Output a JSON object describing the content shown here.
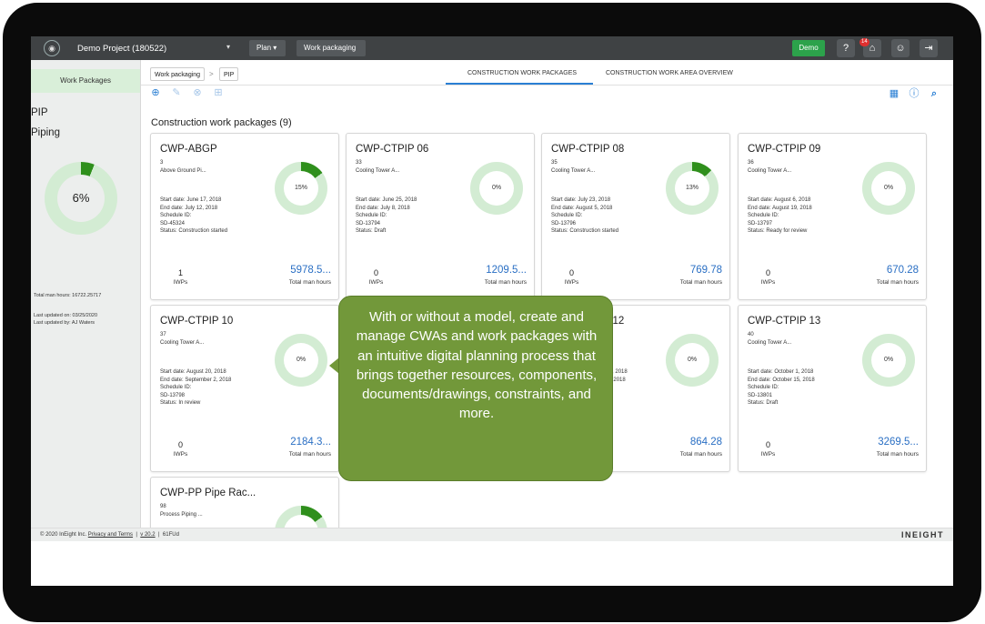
{
  "topbar": {
    "project": "Demo Project (180522)",
    "nav1": "Plan",
    "nav2": "Work packaging",
    "demo_button": "Demo",
    "notification_count": "14",
    "icons": [
      "help-icon",
      "bell-icon",
      "user-icon",
      "logout-icon"
    ]
  },
  "sidebar": {
    "tab": "Work Packages",
    "heading1": "PIP",
    "heading2": "Piping",
    "donut_percent_label": "6%",
    "donut_fraction": 0.06,
    "total_man_hours": "Total man hours: 16722.25717",
    "last_updated_on": "Last updated on: 03/25/2020",
    "last_updated_by": "Last updated by: AJ Waters"
  },
  "breadcrumb": {
    "item1": "Work packaging",
    "sep": ">",
    "item2": "PIP"
  },
  "tabs": {
    "tab1": "CONSTRUCTION WORK PACKAGES",
    "tab2": "CONSTRUCTION WORK AREA OVERVIEW"
  },
  "section_title": "Construction work packages (9)",
  "cards": [
    {
      "title": "CWP-ABGP",
      "num": "3",
      "sub": "Above Ground Pi...",
      "start": "Start date: June 17, 2018",
      "end": "End date: July 12, 2018",
      "schedule_label": "Schedule ID:",
      "schedule": "SD-45324",
      "status": "Status: Construction started",
      "percent": "15%",
      "fraction": 0.15,
      "iwps": "1",
      "iwps_label": "IWPs",
      "man_hours": "5978.5...",
      "man_hours_label": "Total man hours"
    },
    {
      "title": "CWP-CTPIP 06",
      "num": "33",
      "sub": "Cooling Tower A...",
      "start": "Start date: June 25, 2018",
      "end": "End date: July 8, 2018",
      "schedule_label": "Schedule ID:",
      "schedule": "SD-13794",
      "status": "Status: Draft",
      "percent": "0%",
      "fraction": 0,
      "iwps": "0",
      "iwps_label": "IWPs",
      "man_hours": "1209.5...",
      "man_hours_label": "Total man hours"
    },
    {
      "title": "CWP-CTPIP 08",
      "num": "35",
      "sub": "Cooling Tower A...",
      "start": "Start date: July 23, 2018",
      "end": "End date: August 5, 2018",
      "schedule_label": "Schedule ID:",
      "schedule": "SD-13796",
      "status": "Status: Construction started",
      "percent": "13%",
      "fraction": 0.13,
      "iwps": "0",
      "iwps_label": "IWPs",
      "man_hours": "769.78",
      "man_hours_label": "Total man hours"
    },
    {
      "title": "CWP-CTPIP 09",
      "num": "36",
      "sub": "Cooling Tower A...",
      "start": "Start date: August 6, 2018",
      "end": "End date: August 19, 2018",
      "schedule_label": "Schedule ID:",
      "schedule": "SD-13797",
      "status": "Status: Ready for review",
      "percent": "0%",
      "fraction": 0,
      "iwps": "0",
      "iwps_label": "IWPs",
      "man_hours": "670.28",
      "man_hours_label": "Total man hours"
    },
    {
      "title": "CWP-CTPIP 10",
      "num": "37",
      "sub": "Cooling Tower A...",
      "start": "Start date: August 20, 2018",
      "end": "End date: September 2, 2018",
      "schedule_label": "Schedule ID:",
      "schedule": "SD-13798",
      "status": "Status: In review",
      "percent": "0%",
      "fraction": 0,
      "iwps": "0",
      "iwps_label": "IWPs",
      "man_hours": "2184.3...",
      "man_hours_label": "Total man hours"
    },
    {
      "title": "",
      "num": "",
      "sub": "",
      "start": "",
      "end": "",
      "schedule_label": "",
      "schedule": "",
      "status": "",
      "percent": "",
      "fraction": 0,
      "iwps": "",
      "iwps_label": "",
      "man_hours": "",
      "man_hours_label": ""
    },
    {
      "title": "CWP-CTPIP 12",
      "num": "",
      "sub": "",
      "start": "Start date: September 17, 2018",
      "end": "End date: September 30, 2018",
      "schedule_label": "",
      "schedule": "",
      "status": "",
      "percent": "0%",
      "fraction": 0,
      "iwps": "",
      "iwps_label": "",
      "man_hours": "864.28",
      "man_hours_label": "Total man hours"
    },
    {
      "title": "CWP-CTPIP 13",
      "num": "40",
      "sub": "Cooling Tower A...",
      "start": "Start date: October 1, 2018",
      "end": "End date: October 15, 2018",
      "schedule_label": "Schedule ID:",
      "schedule": "SD-13801",
      "status": "Status: Draft",
      "percent": "0%",
      "fraction": 0,
      "iwps": "0",
      "iwps_label": "IWPs",
      "man_hours": "3269.5...",
      "man_hours_label": "Total man hours"
    },
    {
      "title": "CWP-PP Pipe Rac...",
      "num": "98",
      "sub": "Process Piping ...",
      "start": "",
      "end": "",
      "schedule_label": "",
      "schedule": "",
      "status": "",
      "percent": "",
      "fraction": 0.15,
      "iwps": "",
      "iwps_label": "",
      "man_hours": "",
      "man_hours_label": ""
    }
  ],
  "footer": {
    "copyright": "© 2020 InEight Inc.",
    "privacy": "Privacy and Terms",
    "sep": "|",
    "version": "v 20.2",
    "build": "61FUd",
    "brand": "INEIGHT"
  },
  "callout": "With or without a model, create and manage CWAs and work packages with an intuitive digital planning process that brings together resources, components, documents/drawings, constraints, and more.",
  "colors": {
    "accent": "#2a7fd4",
    "progress": "#2f8f1c",
    "progress_bg": "#d3ecd3",
    "callout": "#72983a",
    "demo": "#2ca24b"
  }
}
